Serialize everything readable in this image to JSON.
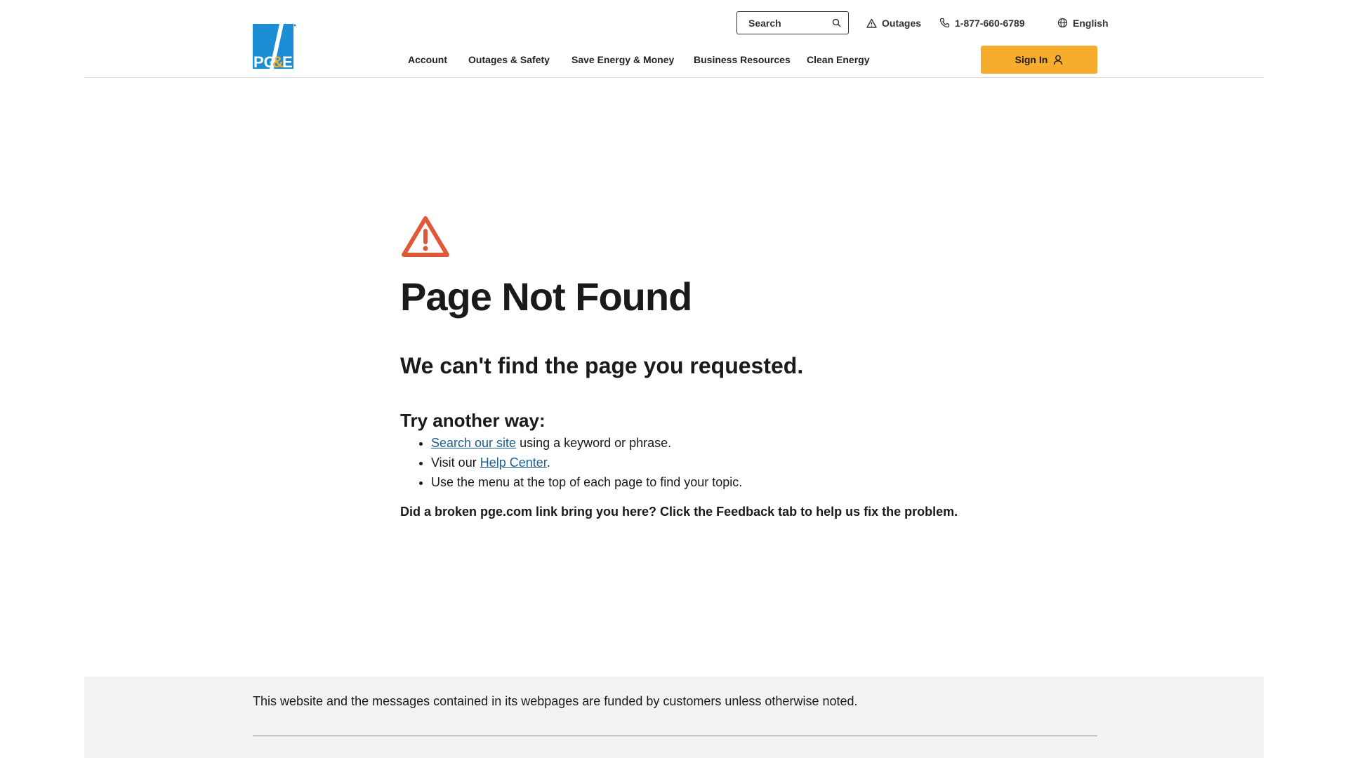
{
  "header": {
    "logo_text": "PG&E",
    "search": {
      "placeholder": "Search"
    },
    "utility": {
      "outages_label": "Outages",
      "phone_label": "1-877-660-6789",
      "language_label": "English"
    },
    "nav": [
      {
        "label": "Account"
      },
      {
        "label": "Outages & Safety"
      },
      {
        "label": "Save Energy & Money"
      },
      {
        "label": "Business Resources"
      },
      {
        "label": "Clean Energy"
      }
    ],
    "sign_in_label": "Sign In"
  },
  "main": {
    "title": "Page Not Found",
    "subtitle": "We can't find the page you requested.",
    "try_heading": "Try another way:",
    "items": [
      {
        "link": "Search our site",
        "text": " using a keyword or phrase."
      },
      {
        "prefix": "Visit our ",
        "link": "Help Center",
        "text": "."
      },
      {
        "text": "Use the menu at the top of each page to find your topic."
      }
    ],
    "note": "Did a broken pge.com link bring you here? Click the Feedback tab to help us fix the problem."
  },
  "footer": {
    "text": "This website and the messages contained in its webpages are funded by customers unless otherwise noted."
  },
  "colors": {
    "accent": "#f6ac2c",
    "warning": "#e0583a",
    "link": "#1f5f8f",
    "logo_blue": "#1b8ed6",
    "footer_bg": "#f1f2f4"
  },
  "icons": [
    "search-icon",
    "warning-triangle-icon",
    "phone-icon",
    "globe-icon",
    "user-icon"
  ]
}
